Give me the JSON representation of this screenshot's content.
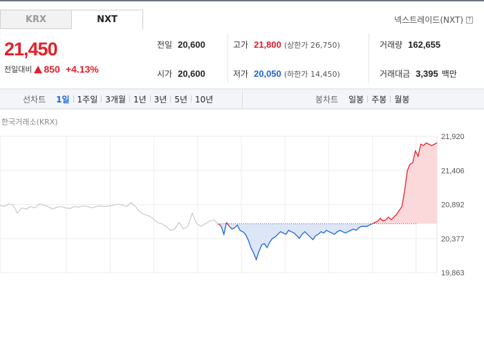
{
  "tabs": [
    {
      "label": "KRX",
      "active": false
    },
    {
      "label": "NXT",
      "active": true
    }
  ],
  "market_label": "넥스트레이드(NXT)",
  "help_glyph": "?",
  "price": {
    "current": "21,450",
    "change_label": "전일대비",
    "change_amount": "850",
    "change_percent": "+4.13%"
  },
  "stats": {
    "prev_close": {
      "label": "전일",
      "value": "20,600"
    },
    "open": {
      "label": "시가",
      "value": "20,600"
    },
    "high": {
      "label": "고가",
      "value": "21,800",
      "sub": "(상한가 26,750)"
    },
    "low": {
      "label": "저가",
      "value": "20,050",
      "sub": "(하한가 14,450)"
    },
    "volume": {
      "label": "거래량",
      "value": "162,655"
    },
    "turnover": {
      "label": "거래대금",
      "value": "3,395",
      "unit": "백만"
    }
  },
  "toolbar": {
    "line_label": "선차트",
    "line_periods": [
      "1일",
      "1주일",
      "3개월",
      "1년",
      "3년",
      "5년",
      "10년"
    ],
    "selected_period": "1일",
    "candle_label": "봉차트",
    "candle_periods": [
      "일봉",
      "주봉",
      "월봉"
    ]
  },
  "exchange_label": "한국거래소(KRX)",
  "colors": {
    "up": "#e3202a",
    "down": "#1e64d2",
    "krx_line": "#c8c8c8",
    "up_fill": "#fbd9db",
    "down_fill": "#dde6f6"
  },
  "chart_data": {
    "type": "line",
    "title": "",
    "y_ticks": [
      "21,920",
      "21,406",
      "20,892",
      "20,377",
      "19,863"
    ],
    "ylim": [
      19863,
      21920
    ],
    "baseline": 20600,
    "grid": true,
    "series": [
      {
        "kind": "krx",
        "values": [
          20880,
          20860,
          20900,
          20880,
          20760,
          20840,
          20820,
          20860,
          20840,
          20900,
          20880,
          20860,
          20820,
          20850,
          20860,
          20840,
          20830,
          20860,
          20850,
          20870,
          20860,
          20840,
          20860,
          20870,
          20860,
          20870,
          20880,
          20900,
          20880,
          20860,
          20920,
          20860,
          20780,
          20740,
          20720,
          20680,
          20620,
          20600,
          20560,
          20500,
          20520,
          20620,
          20520,
          20560,
          20760,
          20600,
          20560,
          20600,
          20640,
          20660,
          20580
        ]
      },
      {
        "kind": "nxt",
        "values": [
          20600,
          20560,
          20440,
          20620,
          20560,
          20520,
          20540,
          20580,
          20500,
          20480,
          20440,
          20360,
          20240,
          20160,
          20060,
          20180,
          20280,
          20300,
          20240,
          20320,
          20380,
          20400,
          20440,
          20480,
          20460,
          20440,
          20500,
          20480,
          20460,
          20420,
          20380,
          20440,
          20480,
          20440,
          20400,
          20360,
          20420,
          20440,
          20480,
          20460,
          20500,
          20480,
          20460,
          20440,
          20480,
          20500,
          20480,
          20460,
          20480,
          20500,
          20520,
          20500,
          20540,
          20560,
          20560,
          20560,
          20580,
          20600,
          20620,
          20640,
          20680,
          20640,
          20660,
          20700,
          20660,
          20700,
          20740,
          20800,
          20860,
          21100,
          21400,
          21500,
          21520,
          21700,
          21620,
          21800,
          21780,
          21820,
          21800,
          21780,
          21800,
          21820
        ]
      }
    ]
  }
}
